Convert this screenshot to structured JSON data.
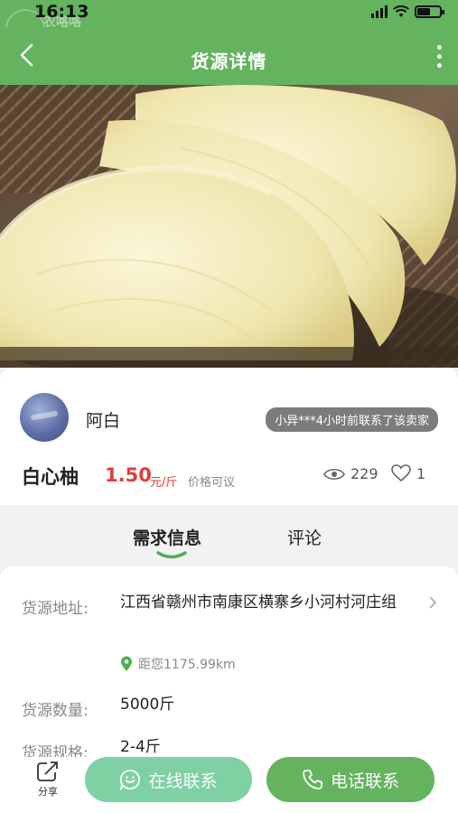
{
  "status_bar": {
    "time": "16:13",
    "logo_text": "农咯咯"
  },
  "nav": {
    "title": "货源详情"
  },
  "carousel": {
    "page_count": 2,
    "active_index": 0
  },
  "seller": {
    "name": "阿白",
    "contact_notice": "小异***4小时前联系了该卖家"
  },
  "product": {
    "name": "白心柚",
    "price": "1.50",
    "price_unit": "元/斤",
    "negotiable": "价格可议",
    "views": "229",
    "likes": "1"
  },
  "tabs": {
    "demand": "需求信息",
    "comments": "评论"
  },
  "info": {
    "address_label": "货源地址:",
    "address_value": "江西省赣州市南康区横寨乡小河村河庄组",
    "distance": "距您1175.99km",
    "quantity_label": "货源数量:",
    "quantity_value": "5000斤",
    "spec_label": "货源规格:",
    "spec_value": "2-4斤"
  },
  "bottom": {
    "share": "分享",
    "online_contact": "在线联系",
    "phone_contact": "电话联系"
  },
  "colors": {
    "brand_green": "#63b35f",
    "price_red": "#e23b3b",
    "online_button": "#7fd0a3"
  }
}
